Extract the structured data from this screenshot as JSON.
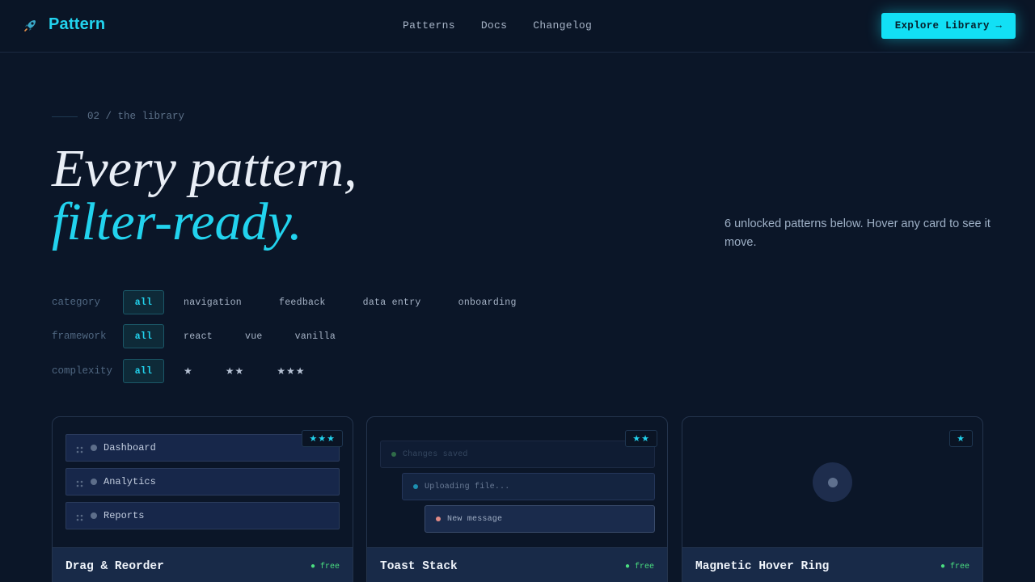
{
  "header": {
    "brand": "Pattern",
    "nav": [
      "Patterns",
      "Docs",
      "Changelog"
    ],
    "cta_label": "Explore Library →"
  },
  "hero": {
    "eyebrow": "02 / the library",
    "title_line1": "Every pattern,",
    "title_line2": "filter-ready.",
    "description": "6 unlocked patterns below. Hover any card to see it move."
  },
  "filters": {
    "category": {
      "label": "category",
      "options": [
        "all",
        "navigation",
        "feedback",
        "data entry",
        "onboarding"
      ],
      "selected": "all"
    },
    "framework": {
      "label": "framework",
      "options": [
        "all",
        "react",
        "vue",
        "vanilla"
      ],
      "selected": "all"
    },
    "complexity": {
      "label": "complexity",
      "options": [
        "all",
        "★",
        "★★",
        "★★★"
      ],
      "selected": "all"
    }
  },
  "cards": [
    {
      "title": "Drag & Reorder",
      "badge": "● free",
      "stars": "★★★",
      "items": [
        "Dashboard",
        "Analytics",
        "Reports"
      ]
    },
    {
      "title": "Toast Stack",
      "badge": "● free",
      "stars": "★★",
      "toasts": [
        "Changes saved",
        "Uploading file...",
        "New message"
      ]
    },
    {
      "title": "Magnetic Hover Ring",
      "badge": "● free",
      "stars": "★"
    }
  ],
  "colors": {
    "accent": "#22d3ee",
    "background": "#0b1628",
    "success": "#4ade80"
  },
  "icons": {
    "brand": "rocket-icon",
    "grip": "grip-dots-icon"
  }
}
